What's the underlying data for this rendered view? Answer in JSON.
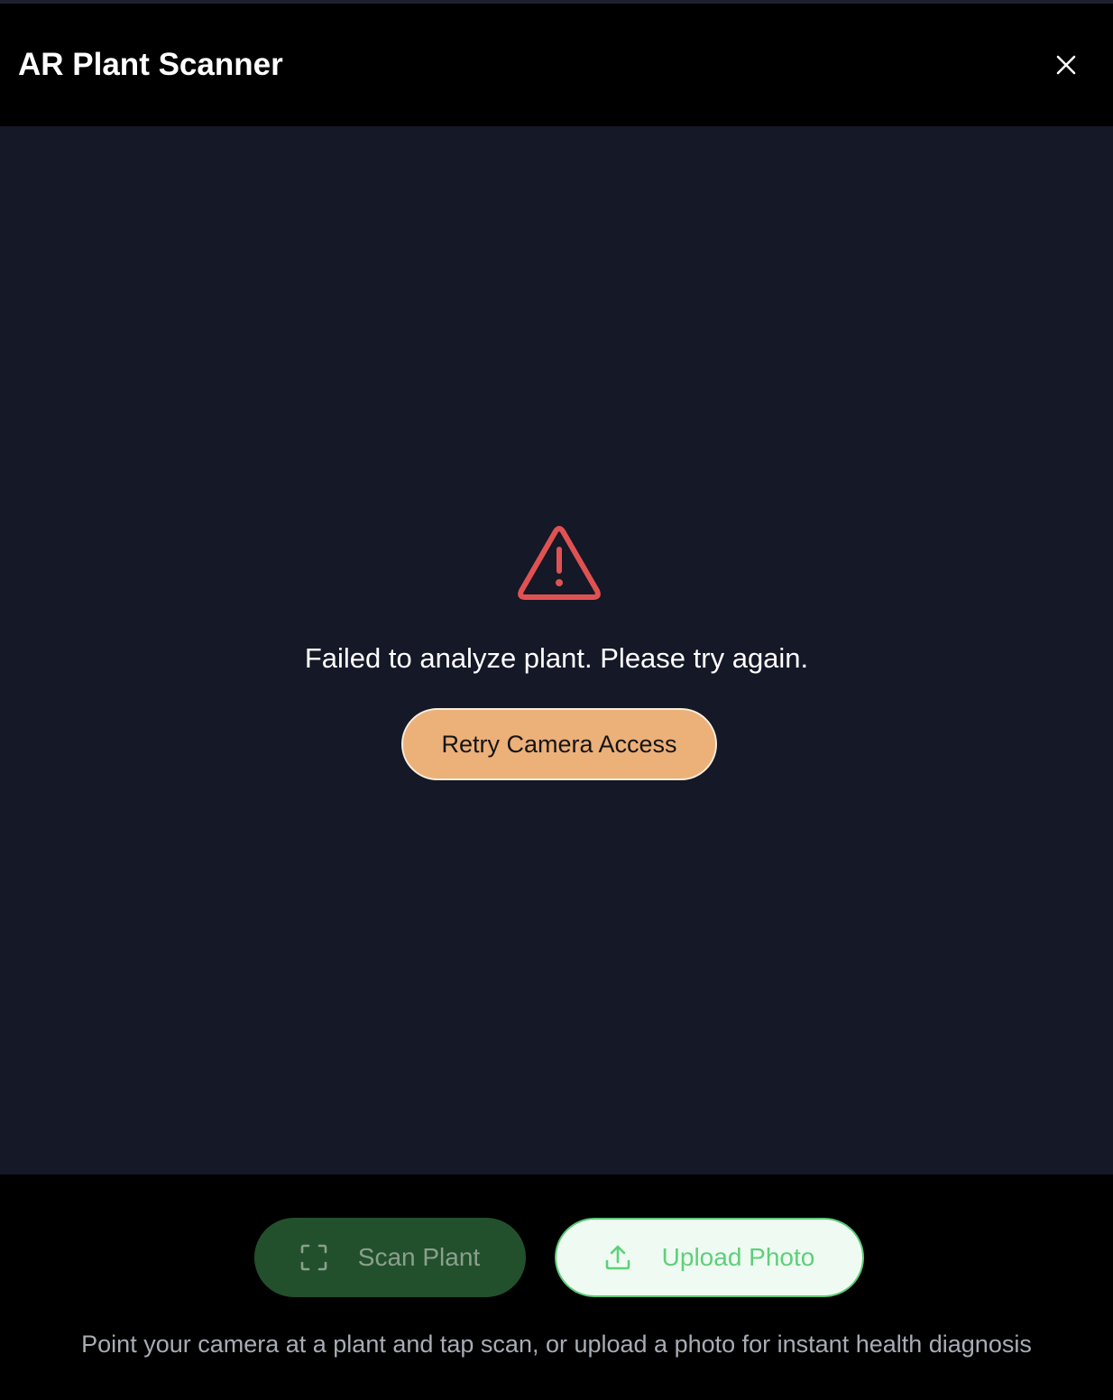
{
  "header": {
    "title": "AR Plant Scanner",
    "close_icon": "close-icon"
  },
  "error": {
    "icon": "warning-triangle-icon",
    "message": "Failed to analyze plant. Please try again.",
    "retry_label": "Retry Camera Access"
  },
  "actions": {
    "scan_label": "Scan Plant",
    "scan_icon": "scan-frame-icon",
    "upload_label": "Upload Photo",
    "upload_icon": "upload-icon"
  },
  "hint": "Point your camera at a plant and tap scan, or upload a photo for instant health diagnosis",
  "colors": {
    "background": "#000000",
    "viewport": "#141827",
    "warning": "#e05252",
    "retry_button": "#ecb079",
    "scan_button": "#23502c",
    "upload_border": "#5cc978",
    "upload_text": "#5fcf7b"
  }
}
